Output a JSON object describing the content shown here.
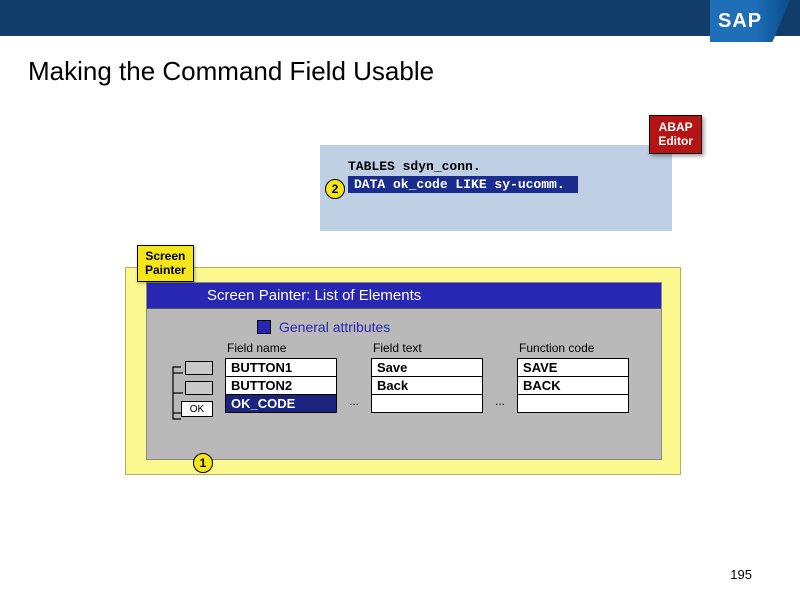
{
  "header": {
    "logo": "SAP"
  },
  "slide": {
    "title": "Making the Command Field Usable",
    "page_number": "195"
  },
  "abap_editor": {
    "label_line1": "ABAP",
    "label_line2": "Editor",
    "code_line1": "TABLES sdyn_conn.",
    "code_line2": "DATA ok_code LIKE sy-ucomm.",
    "step": "2"
  },
  "screen_painter": {
    "label_line1": "Screen",
    "label_line2": "Painter",
    "title": "Screen Painter: List of Elements",
    "general_attributes": "General attributes",
    "step": "1",
    "ok_marker": "OK",
    "columns": {
      "field_name": {
        "header": "Field name",
        "rows": [
          "BUTTON1",
          "BUTTON2",
          "OK_CODE"
        ]
      },
      "field_text": {
        "header": "Field text",
        "rows": [
          "Save",
          "Back",
          ""
        ]
      },
      "function_code": {
        "header": "Function code",
        "rows": [
          "SAVE",
          "BACK",
          ""
        ]
      }
    },
    "ellipsis": "..."
  }
}
